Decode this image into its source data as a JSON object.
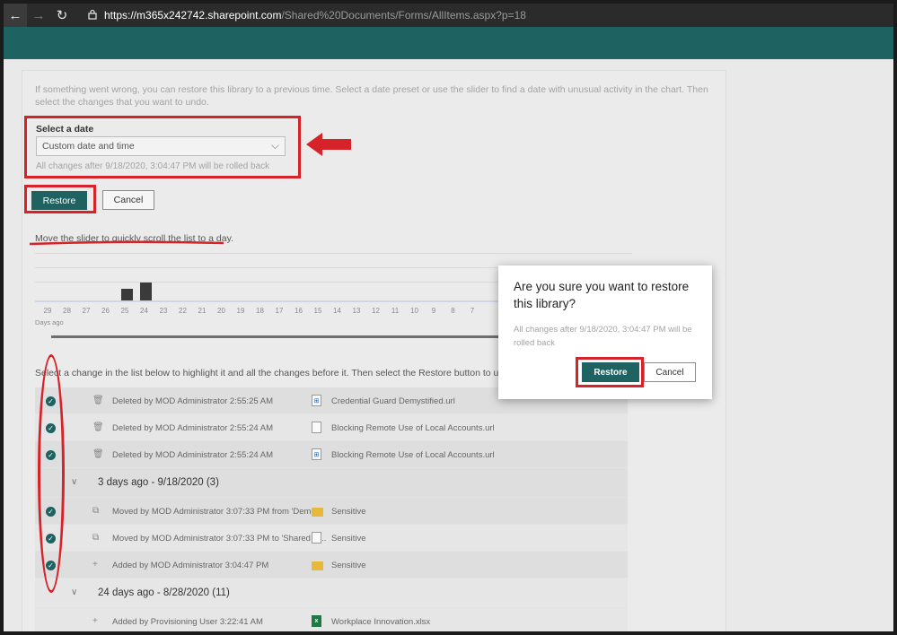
{
  "browser": {
    "url_host": "https://m365x242742.sharepoint.com",
    "url_path": "/Shared%20Documents/Forms/AllItems.aspx?p=18"
  },
  "restore": {
    "intro": "If something went wrong, you can restore this library to a previous time. Select a date preset or use the slider to find a date with unusual activity in the chart. Then select the changes that you want to undo.",
    "select_label": "Select a date",
    "select_value": "Custom date and time",
    "rollback_note": "All changes after 9/18/2020, 3:04:47 PM will be rolled back",
    "restore_label": "Restore",
    "cancel_label": "Cancel",
    "slider_label": "Move the slider to quickly scroll the list to a day.",
    "days_ago_label": "Days ago",
    "list_instruction": "Select a change in the list below to highlight it and all the changes before it. Then select the Restore button to undo all"
  },
  "chart_data": {
    "type": "bar",
    "categories": [
      "29",
      "28",
      "27",
      "26",
      "25",
      "24",
      "23",
      "22",
      "21",
      "20",
      "19",
      "18",
      "17",
      "16",
      "15",
      "14",
      "13",
      "12",
      "11",
      "10",
      "9",
      "8",
      "7"
    ],
    "values": [
      0,
      0,
      0,
      0,
      2,
      3,
      0,
      0,
      0,
      0,
      0,
      0,
      0,
      0,
      0,
      0,
      0,
      0,
      0,
      0,
      0,
      0,
      0
    ],
    "xlabel": "Days ago",
    "ylabel": "",
    "ylim": [
      0,
      8
    ]
  },
  "list": {
    "rows_top": [
      {
        "action": "Deleted by MOD Administrator 2:55:25 AM",
        "file": "Credential Guard Demystified.url",
        "icon": "trash"
      },
      {
        "action": "Deleted by MOD Administrator 2:55:24 AM",
        "file": "Blocking Remote Use of Local Accounts.url",
        "icon": "trash"
      },
      {
        "action": "Deleted by MOD Administrator 2:55:24 AM",
        "file": "Blocking Remote Use of Local Accounts.url",
        "icon": "trash"
      }
    ],
    "group1": "3 days ago - 9/18/2020 (3)",
    "rows_group1": [
      {
        "action": "Moved by MOD Administrator 3:07:33 PM from 'Demo...",
        "file": "Sensitive",
        "icon": "move"
      },
      {
        "action": "Moved by MOD Administrator 3:07:33 PM to 'Shared D...",
        "file": "Sensitive",
        "icon": "move"
      },
      {
        "action": "Added by MOD Administrator 3:04:47 PM",
        "file": "Sensitive",
        "icon": "plus"
      }
    ],
    "group2": "24 days ago - 8/28/2020 (11)",
    "rows_group2": [
      {
        "action": "Added by Provisioning User 3:22:41 AM",
        "file": "Workplace Innovation.xlsx",
        "icon": "plus"
      }
    ]
  },
  "modal": {
    "title": "Are you sure you want to restore this library?",
    "text": "All changes after 9/18/2020, 3:04:47 PM will be rolled back",
    "restore_label": "Restore",
    "cancel_label": "Cancel"
  },
  "colors": {
    "brand": "#1e6262",
    "annotation": "#d6232a"
  }
}
